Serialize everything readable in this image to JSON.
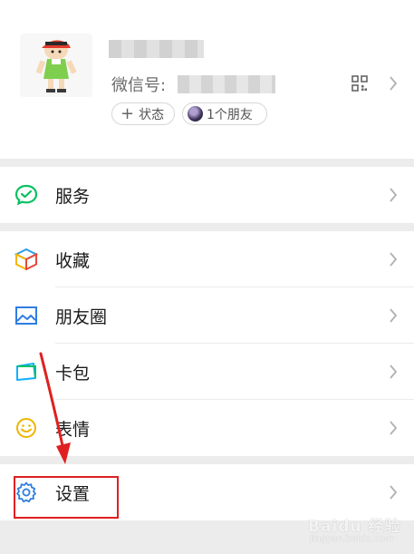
{
  "profile": {
    "wxid_label": "微信号:",
    "status_label": "状态",
    "friends_label": "1个朋友"
  },
  "groups": [
    {
      "items": [
        {
          "label": "服务",
          "icon": "wechat-pay-icon",
          "color": "#07c160"
        }
      ]
    },
    {
      "items": [
        {
          "label": "收藏",
          "icon": "favorites-cube-icon"
        },
        {
          "label": "朋友圈",
          "icon": "moments-image-icon",
          "color": "#2e7de1"
        },
        {
          "label": "卡包",
          "icon": "card-wallet-icon",
          "color": "#10aeff"
        },
        {
          "label": "表情",
          "icon": "sticker-smile-icon",
          "color": "#f0b400"
        }
      ]
    },
    {
      "items": [
        {
          "label": "设置",
          "icon": "settings-gear-icon",
          "color": "#2e7de1"
        }
      ]
    }
  ],
  "annotation": {
    "color": "#e02020"
  },
  "watermark": {
    "text": "Baidu 经验",
    "sub": "jingyan.baidu.com"
  }
}
